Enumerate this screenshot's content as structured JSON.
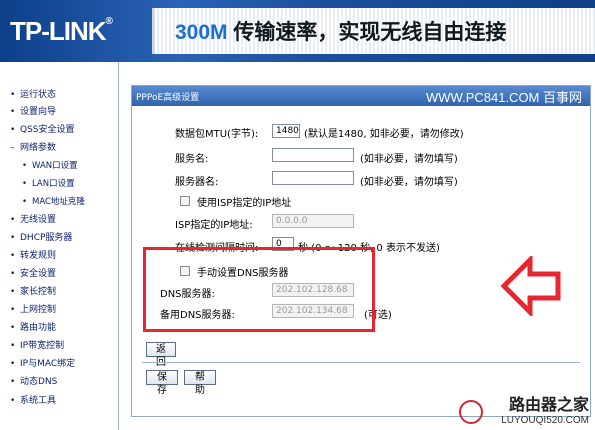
{
  "header": {
    "logo": "TP-LINK",
    "logo_reg": "®",
    "banner_highlight": "300M",
    "banner_text": " 传输速率，实现无线自由连接"
  },
  "sidebar": {
    "items": [
      {
        "label": "运行状态",
        "bullet": "•"
      },
      {
        "label": "设置向导",
        "bullet": "•"
      },
      {
        "label": "QSS安全设置",
        "bullet": "•"
      },
      {
        "label": "网络参数",
        "bullet": "–"
      },
      {
        "label": "WAN口设置",
        "bullet": "•",
        "sub": true
      },
      {
        "label": "LAN口设置",
        "bullet": "•",
        "sub": true
      },
      {
        "label": "MAC地址克隆",
        "bullet": "•",
        "sub": true
      },
      {
        "label": "无线设置",
        "bullet": "•"
      },
      {
        "label": "DHCP服务器",
        "bullet": "•"
      },
      {
        "label": "转发规则",
        "bullet": "•"
      },
      {
        "label": "安全设置",
        "bullet": "•"
      },
      {
        "label": "家长控制",
        "bullet": "•"
      },
      {
        "label": "上网控制",
        "bullet": "•"
      },
      {
        "label": "路由功能",
        "bullet": "•"
      },
      {
        "label": "IP带宽控制",
        "bullet": "•"
      },
      {
        "label": "IP与MAC绑定",
        "bullet": "•"
      },
      {
        "label": "动态DNS",
        "bullet": "•"
      },
      {
        "label": "系统工具",
        "bullet": "•"
      }
    ]
  },
  "panel": {
    "title": "PPPoE高级设置",
    "watermark": "WWW.PC841.COM 百事网",
    "mtu_label": "数据包MTU(字节):",
    "mtu_value": "1480",
    "mtu_hint": "(默认是1480, 如非必要，请勿修改)",
    "service_name_label": "服务名:",
    "service_name_value": "",
    "service_name_hint": "(如非必要，请勿填写)",
    "server_name_label": "服务器名:",
    "server_name_value": "",
    "server_name_hint": "(如非必要，请勿填写)",
    "isp_ip_checkbox_label": "使用ISP指定的IP地址",
    "isp_ip_label": "ISP指定的IP地址:",
    "isp_ip_value": "0.0.0.0",
    "detect_interval_label": "在线检测间隔时间:",
    "detect_interval_value": "0",
    "detect_interval_hint": "秒 (0 ～ 120 秒, 0 表示不发送)",
    "dns_checkbox_label": "手动设置DNS服务器",
    "dns_label": "DNS服务器:",
    "dns_value": "202.102.128.68",
    "dns2_label": "备用DNS服务器:",
    "dns2_value": "202.102.134.68",
    "dns2_hint": "(可选)",
    "back_button": "返 回",
    "save_button": "保 存",
    "help_button": "帮 助"
  },
  "brand_watermark": {
    "name": "路由器之家",
    "url": "LUYOUQI520.COM"
  },
  "colors": {
    "accent": "#3f74c0",
    "highlight_box": "#e8262f",
    "nav_text": "#0a1f6e"
  }
}
